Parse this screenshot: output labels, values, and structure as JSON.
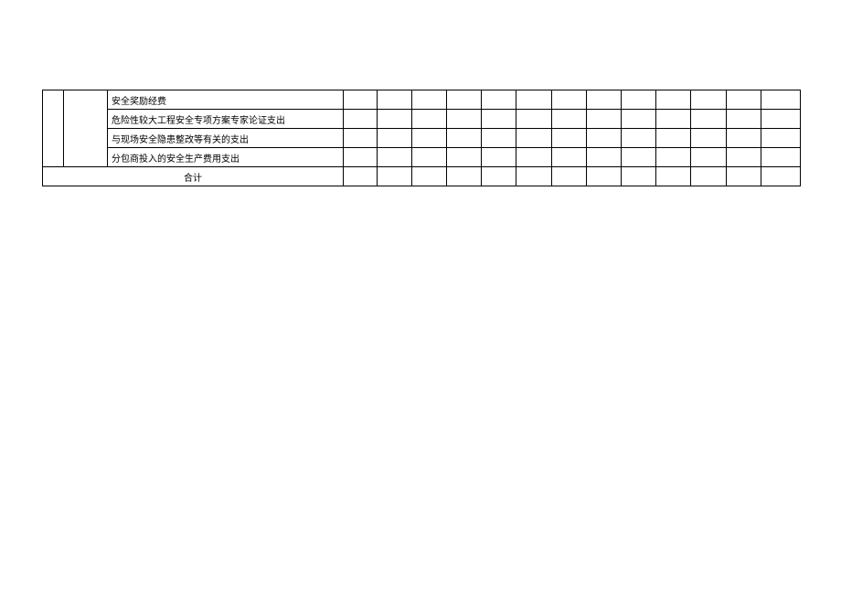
{
  "rows": [
    {
      "desc": "安全奖励经费"
    },
    {
      "desc": "危险性较大工程安全专项方案专家论证支出"
    },
    {
      "desc": "与现场安全隐患整改等有关的支出"
    },
    {
      "desc": "分包商投入的安全生产费用支出"
    }
  ],
  "footer": {
    "total_label": "合计"
  }
}
